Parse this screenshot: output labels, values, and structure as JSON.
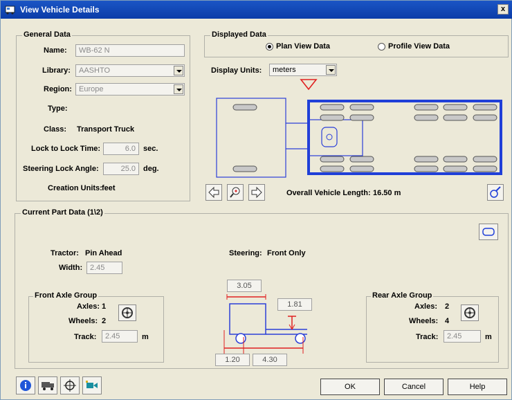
{
  "window": {
    "title": "View Vehicle Details",
    "close_label": "x"
  },
  "general": {
    "legend": "General Data",
    "name_label": "Name:",
    "name_value": "WB-62 N",
    "library_label": "Library:",
    "library_value": "AASHTO",
    "region_label": "Region:",
    "region_value": "Europe",
    "type_label": "Type:",
    "class_label": "Class:",
    "class_value": "Transport Truck",
    "lock_label": "Lock to Lock Time:",
    "lock_value": "6.0",
    "lock_unit": "sec.",
    "steer_label": "Steering Lock Angle:",
    "steer_value": "25.0",
    "steer_unit": "deg.",
    "creation_label": "Creation Units:",
    "creation_value": "feet"
  },
  "displayed": {
    "legend": "Displayed Data",
    "plan_label": "Plan View Data",
    "profile_label": "Profile View Data",
    "units_label": "Display Units:",
    "units_value": "meters",
    "overall_label": "Overall Vehicle Length:",
    "overall_value": "16.50 m"
  },
  "current": {
    "legend": "Current Part Data (1\\2)",
    "tractor_label": "Tractor:",
    "tractor_value": "Pin Ahead",
    "width_label": "Width:",
    "width_value": "2.45",
    "steering_label": "Steering:",
    "steering_value": "Front Only",
    "front": {
      "legend": "Front Axle Group",
      "axles_label": "Axles:",
      "axles_value": "1",
      "wheels_label": "Wheels:",
      "wheels_value": "2",
      "track_label": "Track:",
      "track_value": "2.45",
      "track_unit": "m"
    },
    "rear": {
      "legend": "Rear Axle Group",
      "axles_label": "Axles:",
      "axles_value": "2",
      "wheels_label": "Wheels:",
      "wheels_value": "4",
      "track_label": "Track:",
      "track_value": "2.45",
      "track_unit": "m"
    },
    "dims": {
      "top": "3.05",
      "right": "1.81",
      "bottom_left": "1.20",
      "bottom_right": "4.30"
    }
  },
  "buttons": {
    "ok": "OK",
    "cancel": "Cancel",
    "help": "Help"
  },
  "colors": {
    "accent": "#1f3fd8",
    "marker": "#e02020",
    "dim": "#e02020"
  }
}
